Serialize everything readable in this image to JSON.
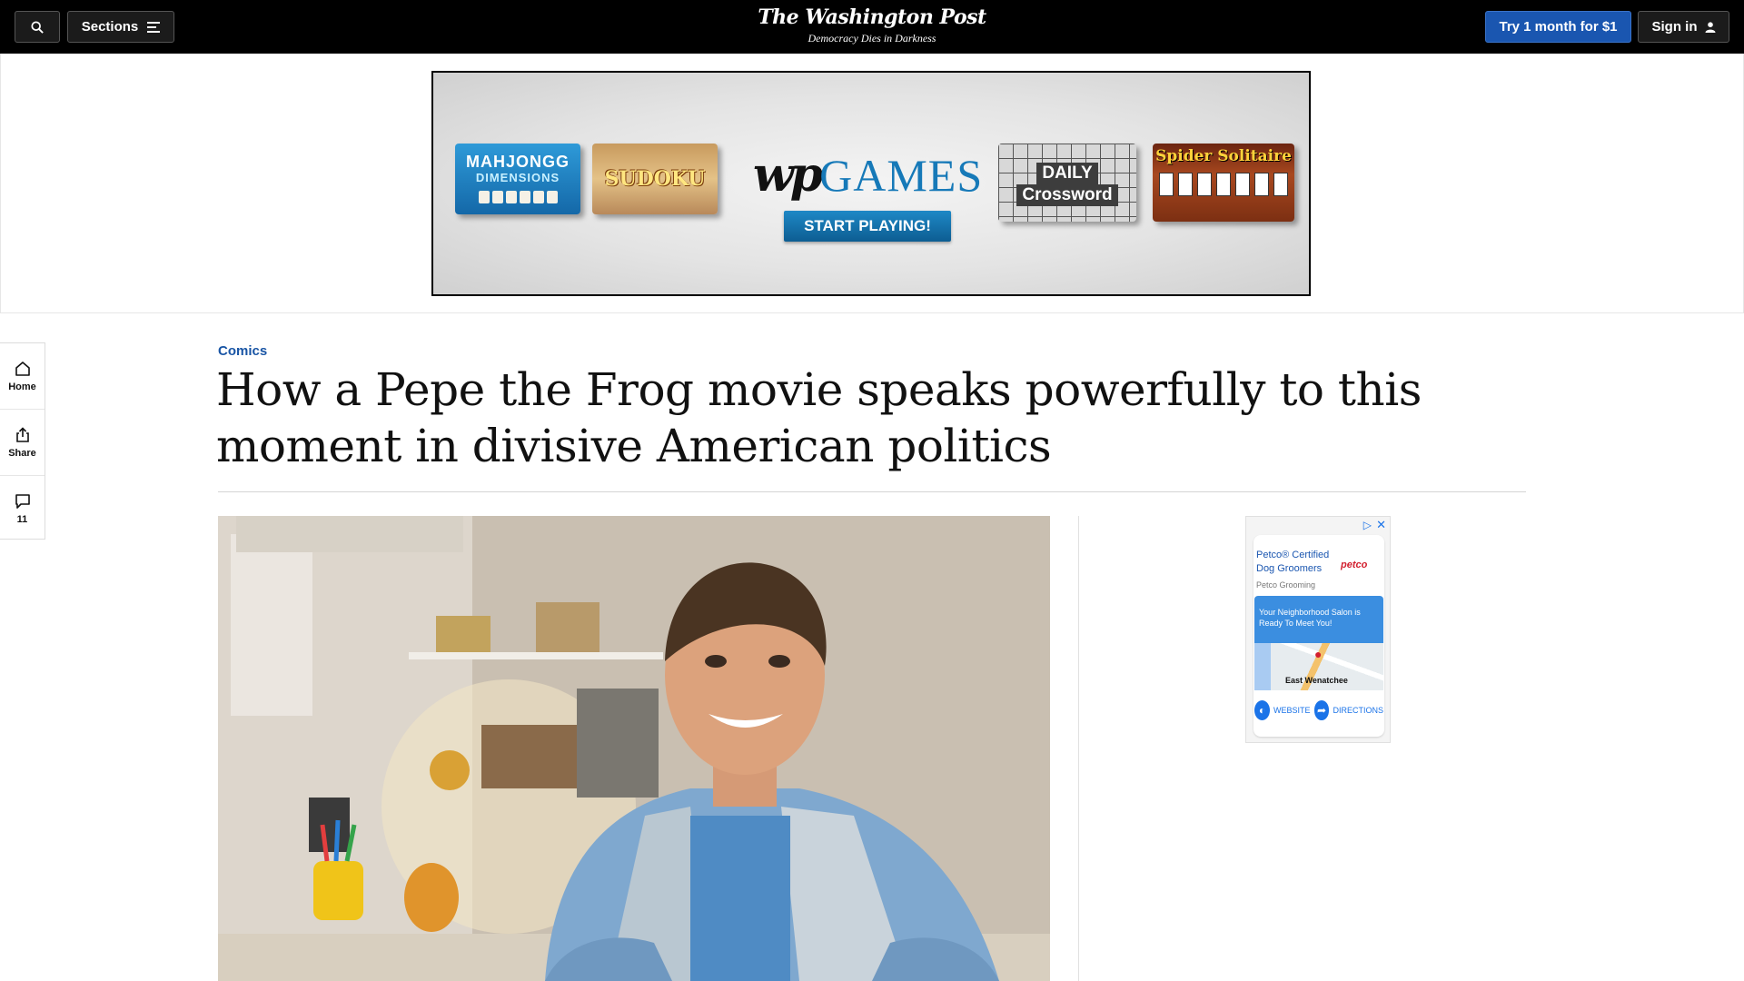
{
  "nav": {
    "sections_label": "Sections",
    "masthead": "The Washington Post",
    "tagline": "Democracy Dies in Darkness",
    "subscribe_label": "Try 1 month for $1",
    "signin_label": "Sign in"
  },
  "top_ad": {
    "tiles": {
      "mahjongg_line1": "MAHJONGG",
      "mahjongg_line2": "DIMENSIONS",
      "sudoku": "SUDOKU",
      "crossword_line1": "DAILY",
      "crossword_line2": "Crossword",
      "spider": "Spider Solitaire"
    },
    "brand_wp": "wp",
    "brand_games": "GAMES",
    "cta": "START PLAYING!"
  },
  "rail": {
    "home": "Home",
    "share": "Share",
    "comments": "11"
  },
  "article": {
    "kicker": "Comics",
    "headline": "How a Pepe the Frog movie speaks powerfully to this moment in divisive American politics"
  },
  "side_ad": {
    "title": "Petco® Certified Dog Groomers",
    "logo": "petco",
    "sub": "Petco Grooming",
    "banner": "Your Neighborhood Salon is Ready To Meet You!",
    "city": "East Wenatchee",
    "website": "WEBSITE",
    "directions": "DIRECTIONS"
  },
  "colors": {
    "topbar": "#000000",
    "subscribe_button": "#1a56b0",
    "kicker": "#1955a5"
  }
}
